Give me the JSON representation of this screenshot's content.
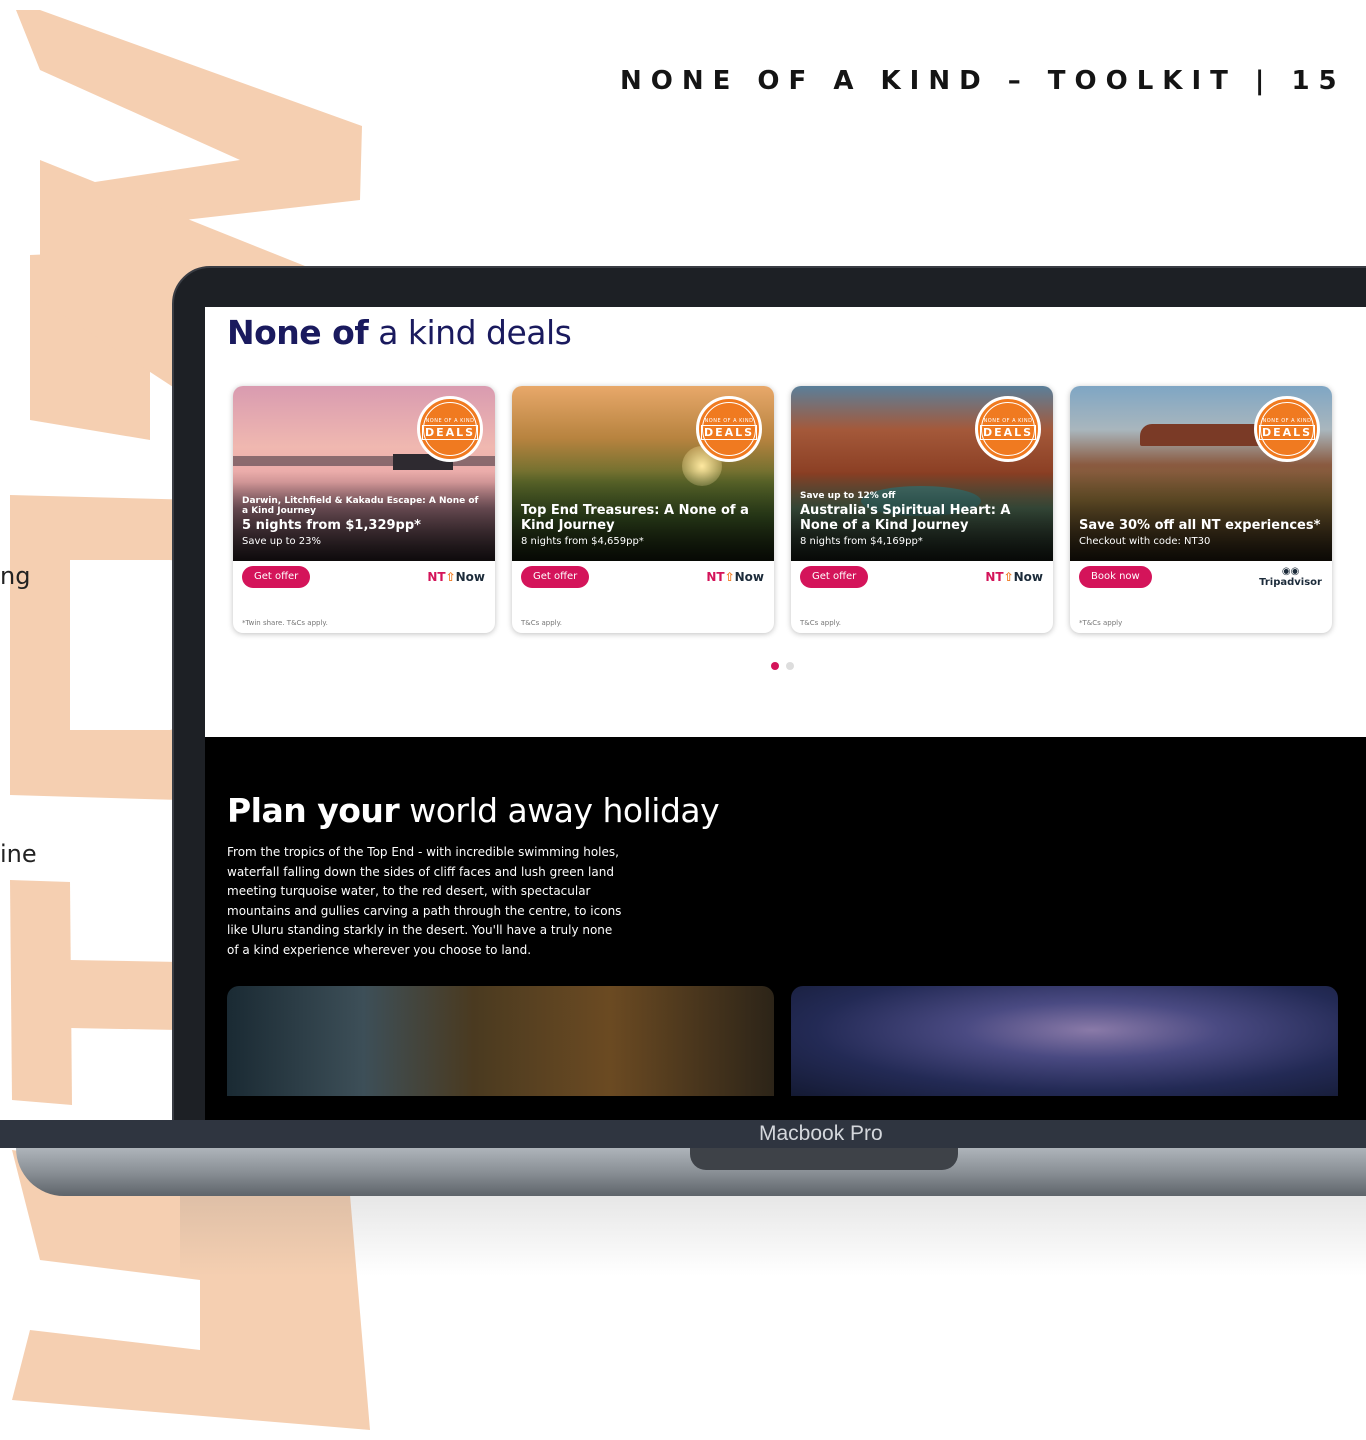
{
  "header": {
    "title": "NONE OF A KIND – TOOLKIT | 15"
  },
  "side_fragments": {
    "line1": "ng",
    "line2": "ine"
  },
  "deals": {
    "title_bold": "None of",
    "title_light": "a kind deals",
    "cards": [
      {
        "pre": "Darwin, Litchfield & Kakadu Escape: A None of a Kind Journey",
        "headline": "5 nights from $1,329pp*",
        "sub": "Save up to 23%",
        "button": "Get offer",
        "brand": "NT Now",
        "terms": "*Twin share. T&Cs apply.",
        "badge_top": "NONE OF A KIND",
        "badge_main": "DEALS"
      },
      {
        "pre": "",
        "headline": "Top End Treasures: A None of a Kind Journey",
        "sub": "8 nights from $4,659pp*",
        "button": "Get offer",
        "brand": "NT Now",
        "terms": "T&Cs apply.",
        "badge_top": "NONE OF A KIND",
        "badge_main": "DEALS"
      },
      {
        "pre": "Save up to 12% off",
        "headline": "Australia's Spiritual Heart: A None of a Kind Journey",
        "sub": "8 nights from $4,169pp*",
        "button": "Get offer",
        "brand": "NT Now",
        "terms": "T&Cs apply.",
        "badge_top": "NONE OF A KIND",
        "badge_main": "DEALS"
      },
      {
        "pre": "",
        "headline": "Save 30% off all NT experiences*",
        "sub": "Checkout with code: NT30",
        "button": "Book now",
        "brand": "Tripadvisor",
        "terms": "*T&Cs apply",
        "badge_top": "NONE OF A KIND",
        "badge_main": "DEALS"
      }
    ],
    "pagination": {
      "total": 2,
      "active": 1
    }
  },
  "plan": {
    "title_bold": "Plan your",
    "title_light": "world away holiday",
    "body": "From the tropics of the Top End - with incredible swimming holes, waterfall falling down the sides of cliff faces and lush green land meeting turquoise water, to the red desert, with spectacular mountains and gullies carving a path through the centre, to icons like Uluru standing starkly in the desert. You'll have a truly none of a kind experience wherever you choose to land."
  },
  "device": {
    "label": "Macbook Pro"
  },
  "colors": {
    "brush": "#f5cfb1",
    "accent": "#d4145a",
    "badge": "#f07a20",
    "navy": "#1a1a5e"
  },
  "icons": [
    "tripadvisor-owl-icon",
    "nt-now-logo-icon",
    "deals-badge-icon"
  ]
}
